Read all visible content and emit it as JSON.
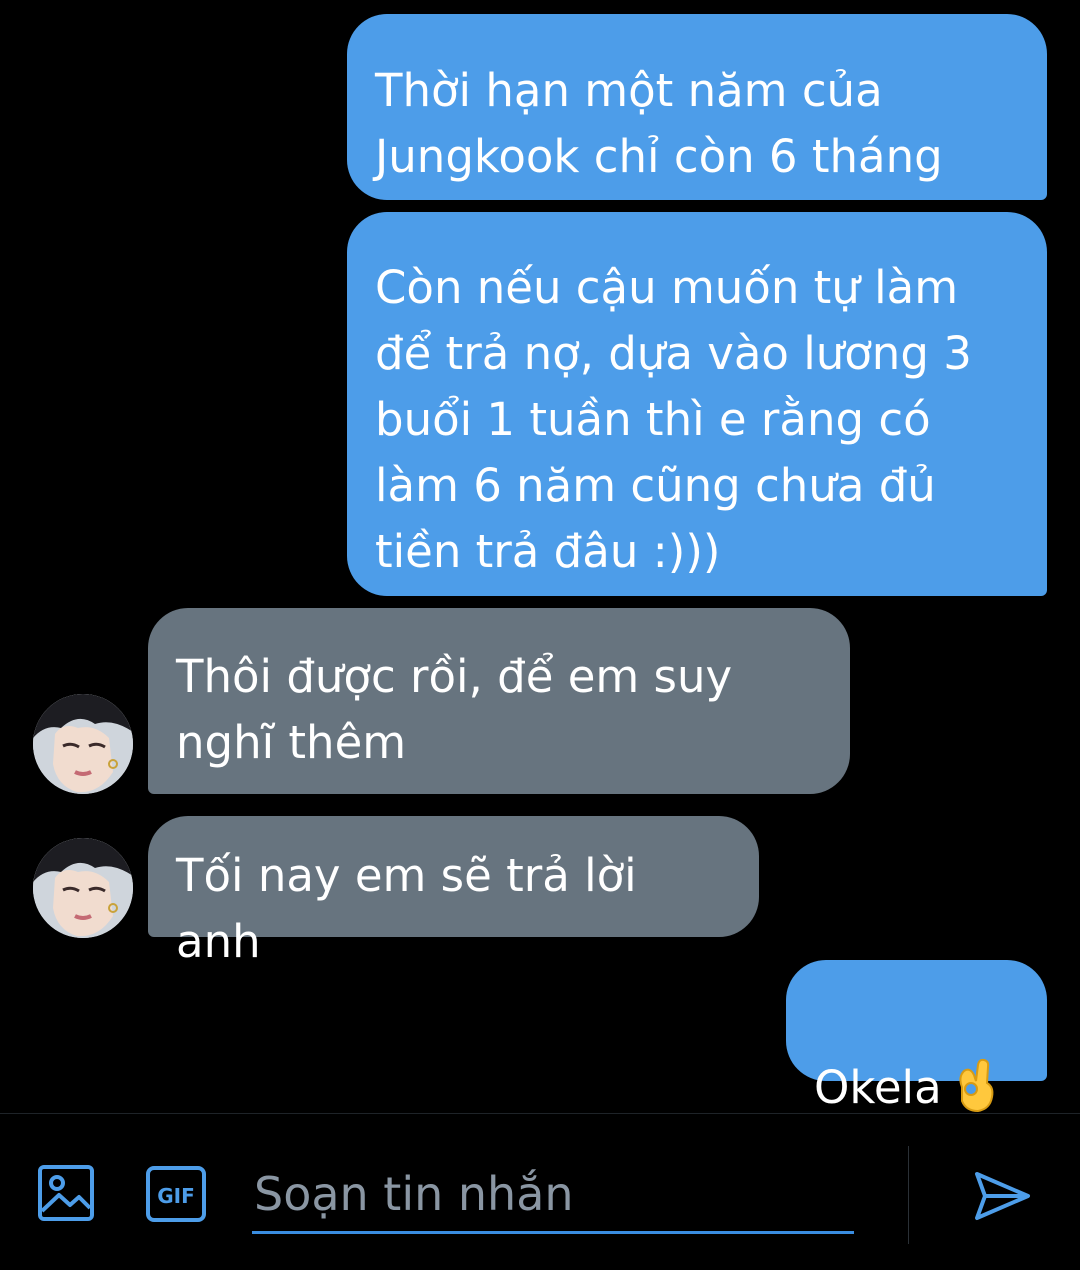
{
  "conversation": {
    "messages": [
      {
        "sender": "me",
        "text": "Thời hạn một năm của\nJungkook chỉ còn 6 tháng"
      },
      {
        "sender": "me",
        "text": "Còn nếu cậu muốn tự làm\nđể trả nợ, dựa vào lương 3\nbuổi 1 tuần thì e rằng có\nlàm 6 năm cũng chưa đủ\ntiền trả đâu :)))"
      },
      {
        "sender": "contact",
        "text": "Thôi được rồi, để em suy\nnghĩ thêm"
      },
      {
        "sender": "contact",
        "text": "Tối nay em sẽ trả lời anh"
      },
      {
        "sender": "me",
        "text": "Okela",
        "emoji": "ok-hand-icon"
      }
    ]
  },
  "composer": {
    "placeholder": "Soạn tin nhắn",
    "gif_label": "GIF",
    "image_icon": "image-icon",
    "send_icon": "send-icon"
  },
  "colors": {
    "sent_bubble": "#4d9de9",
    "received_bubble": "#67747f",
    "accent": "#4d9de9",
    "background": "#000000"
  }
}
